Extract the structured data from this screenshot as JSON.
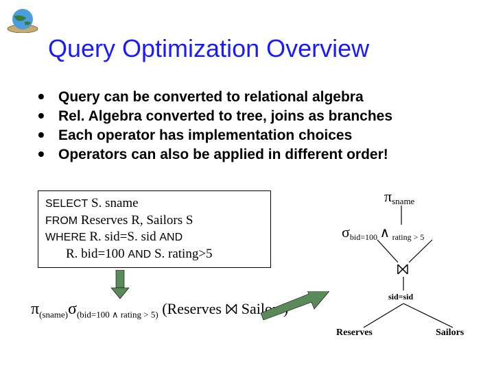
{
  "title": "Query Optimization Overview",
  "bullets": [
    "Query can be converted to relational algebra",
    "Rel. Algebra converted to tree, joins as branches",
    "Each operator has implementation choices",
    "Operators can also be applied in different order!"
  ],
  "sql": {
    "select_kw": "SELECT",
    "select_cols": " S. sname",
    "from_kw": "FROM",
    "from_cols": " Reserves R, Sailors S",
    "where_kw": "WHERE",
    "where_1": " R. sid=S. sid ",
    "and_kw": "AND",
    "where_2": "R. bid=100 ",
    "where_3": " S. rating>5"
  },
  "ra_expression": {
    "pi_sub": "(sname)",
    "sigma_sub": "(bid=100 ∧ rating > 5)",
    "body": " (Reserves ⨝ Sailors)"
  },
  "tree": {
    "project_label": "sname",
    "select_left": "bid=100",
    "select_right": "rating > 5",
    "join_label": "sid=sid",
    "leaf_left": "Reserves",
    "leaf_right": "Sailors"
  }
}
